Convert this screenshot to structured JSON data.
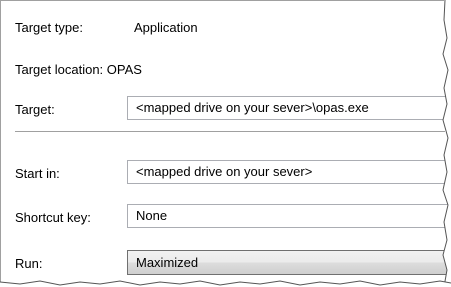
{
  "properties": {
    "target_type_label": "Target type:",
    "target_type_value": "Application",
    "target_location_label": "Target location:",
    "target_location_value": "OPAS",
    "target_label": "Target:",
    "target_value": "<mapped drive on your sever>\\opas.exe",
    "start_in_label": "Start in:",
    "start_in_value": "<mapped drive on your sever>",
    "shortcut_key_label": "Shortcut key:",
    "shortcut_key_value": "None",
    "run_label": "Run:",
    "run_value": "Maximized"
  },
  "colors": {
    "field_border": "#abadb3",
    "separator": "#a0a0a0",
    "combo_gradient_top": "#f2f2f2",
    "combo_gradient_bottom": "#cfcfcf"
  }
}
